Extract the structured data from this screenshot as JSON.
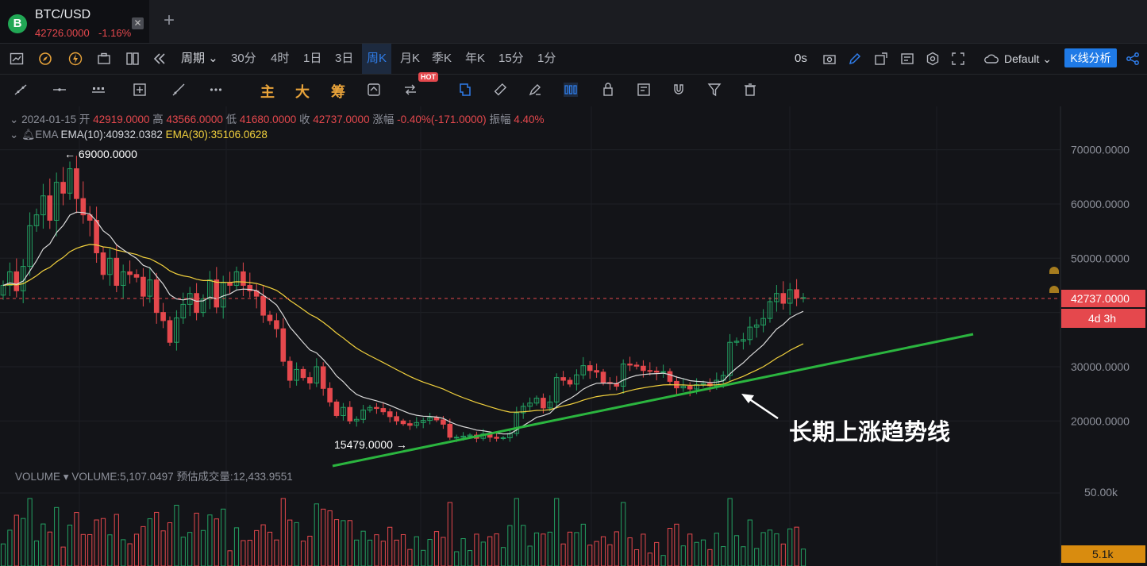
{
  "tab": {
    "title": "BTC/USD",
    "price": "42726.0000",
    "change": "-1.16%",
    "coin_letter": "B"
  },
  "toolbar": {
    "period_label": "周期",
    "periods": [
      "30分",
      "4时",
      "1日",
      "3日",
      "周K",
      "月K",
      "季K",
      "年K",
      "15分",
      "1分"
    ],
    "active_period": "周K",
    "countdown": "0s",
    "theme": "Default",
    "analysis_button": "K线分析"
  },
  "drawing_tools": {
    "main_label": "主",
    "big_label": "大",
    "chip_label": "筹",
    "hot_badge": "HOT"
  },
  "ohlc": {
    "date": "2024-01-15",
    "open_label": "开",
    "open": "42919.0000",
    "high_label": "高",
    "high": "43566.0000",
    "low_label": "低",
    "low": "41680.0000",
    "close_label": "收",
    "close": "42737.0000",
    "change_label": "涨幅",
    "change": "-0.40%(-171.0000)",
    "amplitude_label": "振幅",
    "amplitude": "4.40%"
  },
  "indicators": {
    "name": "EMA",
    "ema10": "EMA(10):40932.0382",
    "ema30": "EMA(30):35106.0628"
  },
  "volume_legend": {
    "name": "VOLUME",
    "volume": "VOLUME:5,107.0497",
    "estimate": "预估成交量:12,433.9551"
  },
  "colors": {
    "up": "#23a162",
    "down": "#e5484d",
    "ema10": "#d9d9d9",
    "ema30": "#f2d13d",
    "trendline": "#2bb53f",
    "accent": "#1f7ae6",
    "volume_tag": "#d98c0f"
  },
  "chart_data": {
    "type": "candlestick",
    "interval": "weekly",
    "y_axis_ticks": [
      70000,
      60000,
      50000,
      40000,
      30000,
      20000
    ],
    "y_tick_labels": [
      "70000.0000",
      "60000.0000",
      "50000.0000",
      "30000.0000",
      "20000.0000"
    ],
    "ylim": [
      15000,
      72000
    ],
    "current_price": 42737,
    "current_price_label": "42737.0000",
    "countdown_label": "4d 3h",
    "high_annotation": {
      "value": 69000,
      "label": "69000.0000"
    },
    "low_annotation": {
      "value": 15479,
      "label": "15479.0000"
    },
    "volume_tick": "50.00k",
    "volume_current_label": "5.1k",
    "annotation_text": "长期上涨趋势线",
    "trendline": {
      "start_close_approx": 16500,
      "end_value_approx": 35000
    },
    "closes": [
      45000,
      47500,
      44000,
      48500,
      56000,
      58000,
      61500,
      57000,
      64000,
      62000,
      66500,
      61000,
      58000,
      57000,
      51000,
      47000,
      50000,
      45000,
      47500,
      47000,
      46500,
      43000,
      46000,
      40000,
      38500,
      34500,
      39000,
      41500,
      43500,
      40000,
      42500,
      46000,
      41000,
      45500,
      45000,
      47500,
      45000,
      44000,
      43000,
      39500,
      38500,
      37000,
      31000,
      27500,
      29500,
      28000,
      27000,
      30000,
      26000,
      23500,
      21000,
      22500,
      20000,
      20300,
      22000,
      22500,
      22300,
      21700,
      20800,
      20000,
      19500,
      19200,
      19700,
      20100,
      20600,
      20200,
      19400,
      17000,
      17000,
      17200,
      17400,
      16800,
      17600,
      17000,
      16800,
      16900,
      17700,
      21500,
      22700,
      23300,
      24200,
      22400,
      23500,
      28000,
      27500,
      26800,
      28500,
      30200,
      29300,
      29000,
      27100,
      26900,
      26400,
      30500,
      30300,
      30100,
      29300,
      29200,
      29000,
      29100,
      27300,
      26100,
      26400,
      25900,
      26700,
      26900,
      26500,
      27500,
      28400,
      34500,
      34700,
      35000,
      37300,
      37700,
      38900,
      42000,
      43500,
      41700,
      44200,
      42700,
      42737
    ]
  }
}
